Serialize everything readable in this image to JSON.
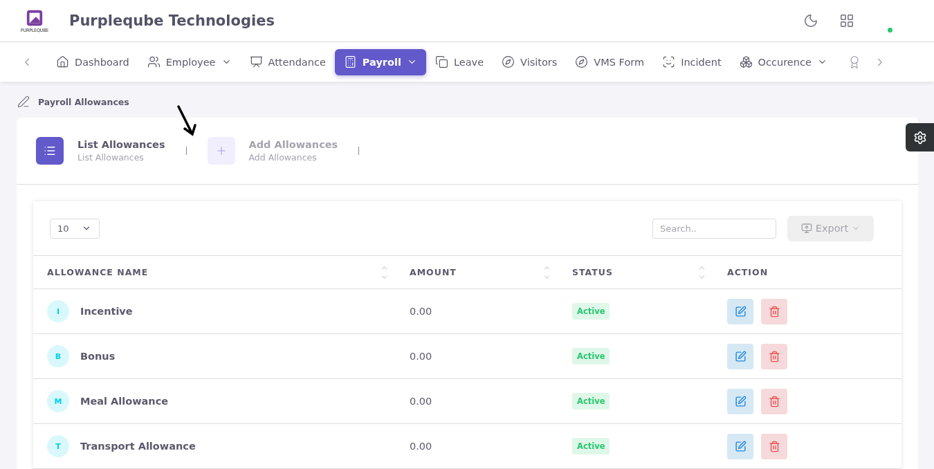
{
  "header": {
    "logo_text": "PURPLEQUBE",
    "company": "Purpleqube Technologies",
    "online": true
  },
  "nav": {
    "items": [
      {
        "label": "Dashboard",
        "selected": false,
        "dropdown": false
      },
      {
        "label": "Employee",
        "selected": false,
        "dropdown": true
      },
      {
        "label": "Attendance",
        "selected": false,
        "dropdown": false
      },
      {
        "label": "Payroll",
        "selected": true,
        "dropdown": true
      },
      {
        "label": "Leave",
        "selected": false,
        "dropdown": false
      },
      {
        "label": "Visitors",
        "selected": false,
        "dropdown": false
      },
      {
        "label": "VMS Form",
        "selected": false,
        "dropdown": false
      },
      {
        "label": "Incident",
        "selected": false,
        "dropdown": false
      },
      {
        "label": "Occurence",
        "selected": false,
        "dropdown": true
      }
    ]
  },
  "breadcrumb": "Payroll Allowances",
  "steps": [
    {
      "title": "List Allowances",
      "subtitle": "List Allowances",
      "selected": true
    },
    {
      "title": "Add Allowances",
      "subtitle": "Add Allowances",
      "selected": false
    }
  ],
  "table": {
    "page_size": "10",
    "search": {
      "placeholder": "Search.."
    },
    "export": "Export",
    "columns": [
      {
        "label": "ALLOWANCE NAME",
        "sortable": true
      },
      {
        "label": "AMOUNT",
        "sortable": true
      },
      {
        "label": "STATUS",
        "sortable": true
      },
      {
        "label": "ACTION",
        "sortable": false
      }
    ],
    "rows": [
      {
        "initial": "I",
        "name": "Incentive",
        "amount": "0.00",
        "status": "Active"
      },
      {
        "initial": "B",
        "name": "Bonus",
        "amount": "0.00",
        "status": "Active"
      },
      {
        "initial": "M",
        "name": "Meal Allowance",
        "amount": "0.00",
        "status": "Active"
      },
      {
        "initial": "T",
        "name": "Transport Allowance",
        "amount": "0.00",
        "status": "Active"
      }
    ]
  }
}
